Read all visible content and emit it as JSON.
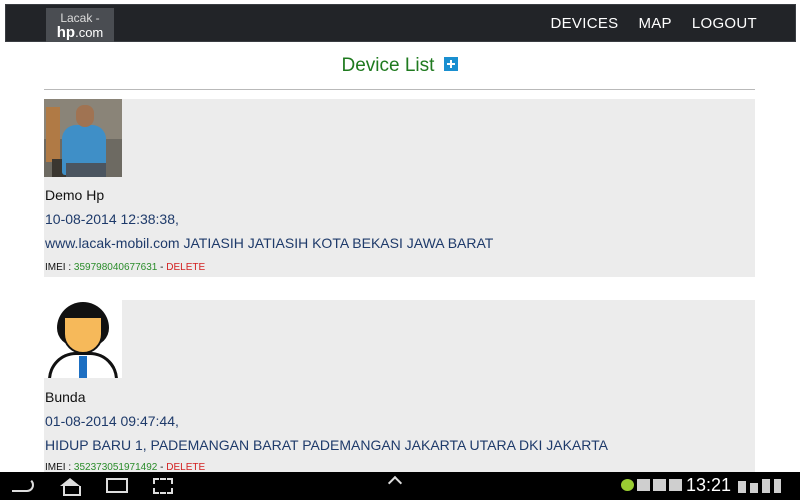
{
  "header": {
    "logo_line1": "Lacak -",
    "logo_line2a": "hp",
    "logo_line2b": ".com",
    "nav": [
      "DEVICES",
      "MAP",
      "LOGOUT"
    ]
  },
  "page": {
    "title": "Device List"
  },
  "devices": [
    {
      "name": "Demo Hp",
      "time": "10-08-2014 12:38:38,",
      "address": "www.lacak-mobil.com JATIASIH JATIASIH KOTA BEKASI JAWA BARAT",
      "imei_label": "IMEI : ",
      "imei": "359798040677631",
      "sep": " - ",
      "delete_label": "DELETE"
    },
    {
      "name": "Bunda",
      "time": "01-08-2014 09:47:44,",
      "address": "HIDUP BARU 1, PADEMANGAN BARAT PADEMANGAN JAKARTA UTARA DKI JAKARTA",
      "imei_label": "IMEI : ",
      "imei": "352373051971492",
      "sep": " - ",
      "delete_label": "DELETE"
    }
  ],
  "system_bar": {
    "clock": "13:21"
  },
  "colors": {
    "title": "#1f7a1f",
    "imei": "#2a8c2a",
    "delete": "#d32020",
    "card_bg": "#ececec",
    "topbar_bg": "#222428"
  }
}
